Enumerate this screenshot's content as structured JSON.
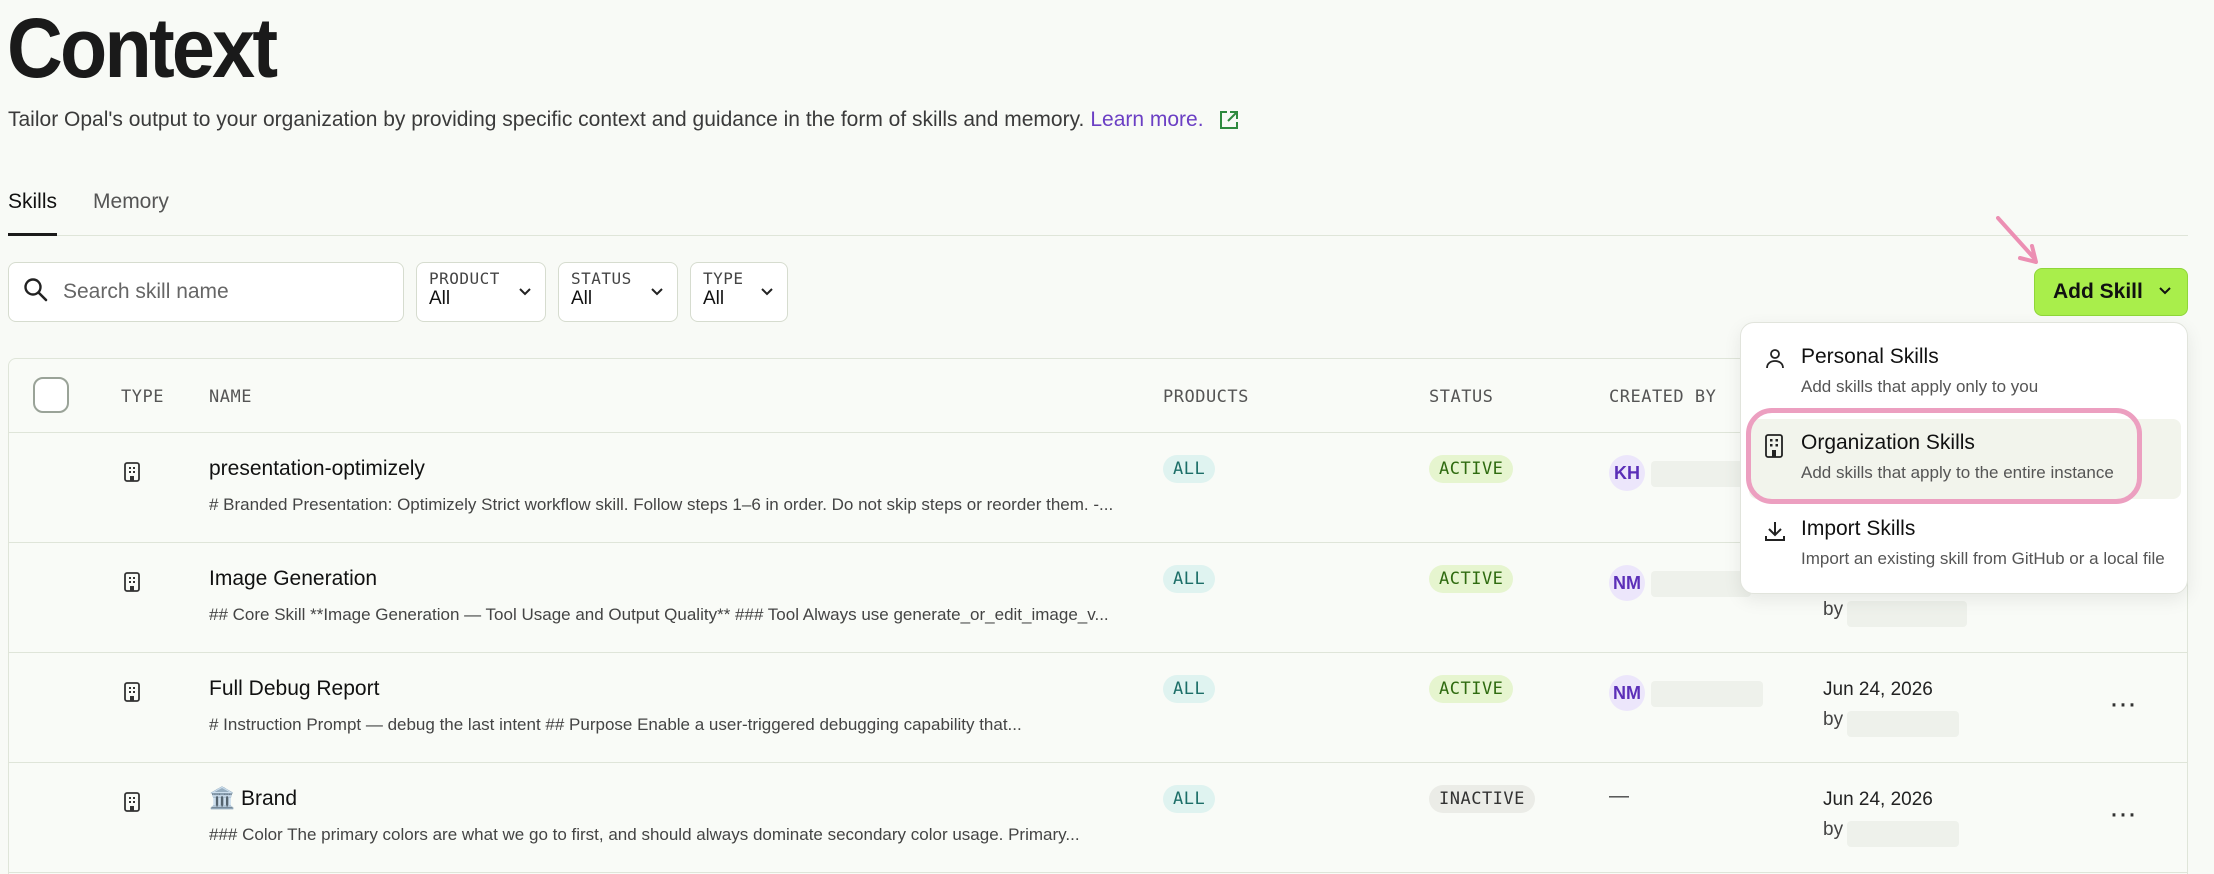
{
  "page": {
    "title": "Context",
    "subtitle": "Tailor Opal's output to your organization by providing specific context and guidance in the form of skills and memory.",
    "learn_more": "Learn more."
  },
  "tabs": [
    {
      "label": "Skills",
      "active": true
    },
    {
      "label": "Memory",
      "active": false
    }
  ],
  "search": {
    "placeholder": "Search skill name",
    "value": ""
  },
  "filters": [
    {
      "label": "PRODUCT",
      "value": "All"
    },
    {
      "label": "STATUS",
      "value": "All"
    },
    {
      "label": "TYPE",
      "value": "All"
    }
  ],
  "add_button": {
    "label": "Add Skill"
  },
  "table": {
    "headers": {
      "type": "TYPE",
      "name": "NAME",
      "products": "PRODUCTS",
      "status": "STATUS",
      "created_by": "CREATED BY"
    },
    "rows": [
      {
        "name": "presentation-optimizely",
        "description": "# Branded Presentation: Optimizely Strict workflow skill. Follow steps 1–6 in order. Do not skip steps or reorder them. -...",
        "products": "ALL",
        "status": "ACTIVE",
        "creator_initials": "KH",
        "date": "",
        "by": ""
      },
      {
        "name": "Image Generation",
        "description": "## Core Skill **Image Generation — Tool Usage and Output Quality** ### Tool Always use generate_or_edit_image_v...",
        "products": "ALL",
        "status": "ACTIVE",
        "creator_initials": "NM",
        "date": "",
        "by": "by"
      },
      {
        "name": "Full Debug Report",
        "description": "# Instruction Prompt — debug the last intent ## Purpose Enable a user-triggered debugging capability that...",
        "products": "ALL",
        "status": "ACTIVE",
        "creator_initials": "NM",
        "date": "Jun 24, 2026",
        "by": "by"
      },
      {
        "name": "🏛️ Brand",
        "description": "### Color The primary colors are what we go to first, and should always dominate secondary color usage. Primary...",
        "products": "ALL",
        "status": "INACTIVE",
        "creator_initials": "—",
        "date": "Jun 24, 2026",
        "by": "by"
      }
    ],
    "more_label": "···"
  },
  "menu": {
    "items": [
      {
        "title": "Personal Skills",
        "desc": "Add skills that apply only to you",
        "icon": "person-icon"
      },
      {
        "title": "Organization Skills",
        "desc": "Add skills that apply to the entire instance",
        "icon": "building-icon"
      },
      {
        "title": "Import Skills",
        "desc": "Import an existing skill from GitHub or a local file",
        "icon": "download-icon"
      }
    ]
  },
  "colors": {
    "accent": "#a9ee4b",
    "link": "#6b3fc4",
    "highlight_ring": "#ec9fc0"
  }
}
